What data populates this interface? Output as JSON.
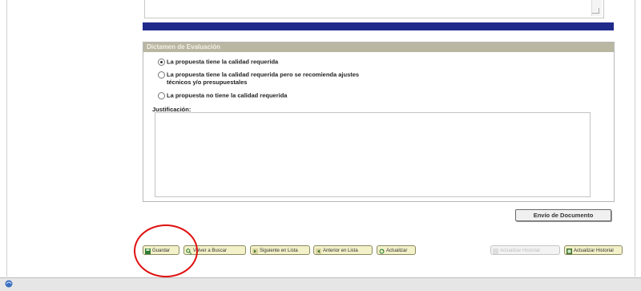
{
  "dictamen": {
    "title": "Dictamen de Evaluación",
    "options": [
      {
        "line1": "La propuesta tiene la calidad requerida",
        "line2": "",
        "selected": true
      },
      {
        "line1": "La propuesta tiene la calidad requerida pero se recomienda ajustes",
        "line2": "técnicos y/o presupuestales",
        "selected": false
      },
      {
        "line1": "La propuesta no tiene la calidad requerida",
        "line2": "",
        "selected": false
      }
    ],
    "justificacion_label": "Justificación:",
    "justificacion_value": ""
  },
  "envio_button": "Envío de Documento",
  "toolbar": {
    "guardar": "Guardar",
    "volver": "Volver a Buscar",
    "siguiente": "Siguiente en Lista",
    "anterior": "Anterior en Lista",
    "actualizar": "Actualizar",
    "disabled_btn": "Actualizar Historial",
    "historial": "Actualizar Historial"
  },
  "colors": {
    "accent_bar": "#202a8a",
    "panel_header": "#b9b6a2",
    "button_bg": "#f2f1c9",
    "highlight_circle": "#e01010"
  },
  "icons": [
    "save-icon",
    "search-icon",
    "next-icon",
    "previous-icon",
    "refresh-icon",
    "history-icon",
    "browser-status-icon"
  ]
}
